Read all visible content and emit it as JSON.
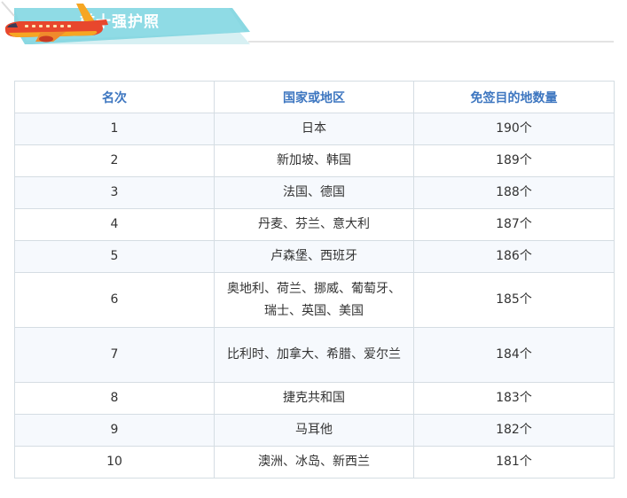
{
  "banner": {
    "title": "前十强护照",
    "colors": {
      "teal": "#8ad8e2",
      "teal_shadow": "#d7f0f3",
      "plane_red": "#e8472d",
      "plane_orange": "#f6a623"
    },
    "icon": "airplane-icon"
  },
  "table": {
    "headers": [
      "名次",
      "国家或地区",
      "免签目的地数量"
    ],
    "rows": [
      {
        "rank": "1",
        "countries": "日本",
        "count": "190个"
      },
      {
        "rank": "2",
        "countries": "新加坡、韩国",
        "count": "189个"
      },
      {
        "rank": "3",
        "countries": "法国、德国",
        "count": "188个"
      },
      {
        "rank": "4",
        "countries": "丹麦、芬兰、意大利",
        "count": "187个"
      },
      {
        "rank": "5",
        "countries": "卢森堡、西班牙",
        "count": "186个"
      },
      {
        "rank": "6",
        "countries": "奥地利、荷兰、挪威、葡萄牙、瑞士、英国、美国",
        "count": "185个"
      },
      {
        "rank": "7",
        "countries": "比利时、加拿大、希腊、爱尔兰",
        "count": "184个"
      },
      {
        "rank": "8",
        "countries": "捷克共和国",
        "count": "183个"
      },
      {
        "rank": "9",
        "countries": "马耳他",
        "count": "182个"
      },
      {
        "rank": "10",
        "countries": "澳洲、冰岛、新西兰",
        "count": "181个"
      }
    ]
  }
}
